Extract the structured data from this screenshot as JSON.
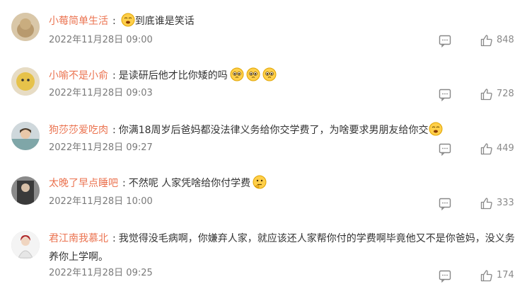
{
  "comments": [
    {
      "username": "小莓简单生活",
      "colon": ":",
      "text": "到底谁是笑话",
      "timestamp": "2022年11月28日 09:00",
      "likes": "848"
    },
    {
      "username": "小喻不是小俞",
      "colon": ":",
      "text": "是读研后他才比你矮的吗",
      "timestamp": "2022年11月28日 09:03",
      "likes": "728"
    },
    {
      "username": "狗莎莎爱吃肉",
      "colon": ":",
      "text": "你满18周岁后爸妈都没法律义务给你交学费了，为啥要求男朋友给你交",
      "timestamp": "2022年11月28日 09:27",
      "likes": "449"
    },
    {
      "username": "太晚了早点睡吧",
      "colon": ":",
      "text": "不然呢 人家凭啥给你付学费",
      "timestamp": "2022年11月28日 10:00",
      "likes": "333"
    },
    {
      "username": "君江南我慕北",
      "colon": ":",
      "text": "我觉得没毛病啊，你嫌弃人家，就应该还人家帮你付的学费啊毕竟他又不是你爸妈，没义务养你上学啊。",
      "timestamp": "2022年11月28日 09:25",
      "likes": "174"
    }
  ],
  "colors": {
    "username": "#eb7350",
    "text": "#333333",
    "meta": "#8a8a8a"
  },
  "icons": {
    "share": "share-icon",
    "like": "thumbs-up-icon"
  }
}
